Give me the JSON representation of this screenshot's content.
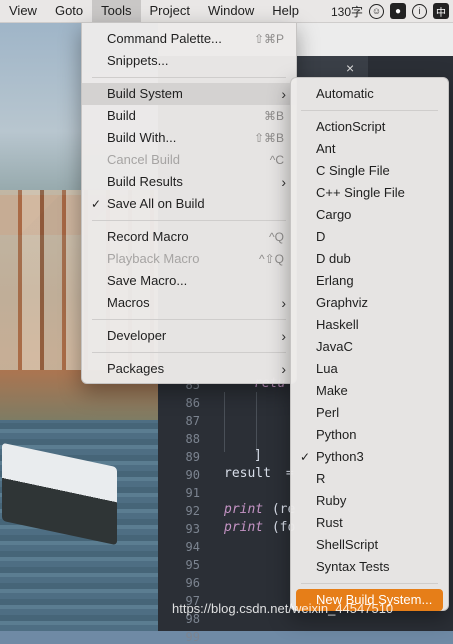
{
  "menubar": {
    "items": [
      "View",
      "Goto",
      "Tools",
      "Project",
      "Window",
      "Help"
    ],
    "tray_text": "130字",
    "tray_ime": "中"
  },
  "editor": {
    "line_numbers": [
      "85",
      "86",
      "87",
      "88",
      "89",
      "90",
      "91",
      "92",
      "93",
      "94",
      "95",
      "96",
      "97",
      "98",
      "99"
    ],
    "code": {
      "line85": "retu",
      "line89": "]",
      "line90_a": "result",
      "line90_b": " =",
      "line92_kw": "print",
      "line92_rest": " (re",
      "line93_kw": "print",
      "line93_rest": " (fo"
    },
    "tab_close": "×"
  },
  "tools_menu": {
    "command_palette": {
      "label": "Command Palette...",
      "shortcut": "⇧⌘P"
    },
    "snippets": {
      "label": "Snippets..."
    },
    "build_system": {
      "label": "Build System"
    },
    "build": {
      "label": "Build",
      "shortcut": "⌘B"
    },
    "build_with": {
      "label": "Build With...",
      "shortcut": "⇧⌘B"
    },
    "cancel_build": {
      "label": "Cancel Build",
      "shortcut": "^C"
    },
    "build_results": {
      "label": "Build Results"
    },
    "save_all_on_build": {
      "label": "Save All on Build",
      "check": "✓"
    },
    "record_macro": {
      "label": "Record Macro",
      "shortcut": "^Q"
    },
    "playback_macro": {
      "label": "Playback Macro",
      "shortcut": "^⇧Q"
    },
    "save_macro": {
      "label": "Save Macro..."
    },
    "macros": {
      "label": "Macros"
    },
    "developer": {
      "label": "Developer"
    },
    "packages": {
      "label": "Packages"
    },
    "arrow": "›"
  },
  "build_system_menu": {
    "automatic": "Automatic",
    "items": [
      "ActionScript",
      "Ant",
      "C Single File",
      "C++ Single File",
      "Cargo",
      "D",
      "D dub",
      "Erlang",
      "Graphviz",
      "Haskell",
      "JavaC",
      "Lua",
      "Make",
      "Perl",
      "Python",
      "Python3",
      "R",
      "Ruby",
      "Rust",
      "ShellScript",
      "Syntax Tests"
    ],
    "checked": "✓",
    "new_build_system": "New Build System..."
  },
  "watermark": "https://blog.csdn.net/weixin_44547510",
  "colors": {
    "accent": "#e67e18",
    "menu_bg": "#eceae9",
    "editor_bg": "#2b2f36"
  }
}
